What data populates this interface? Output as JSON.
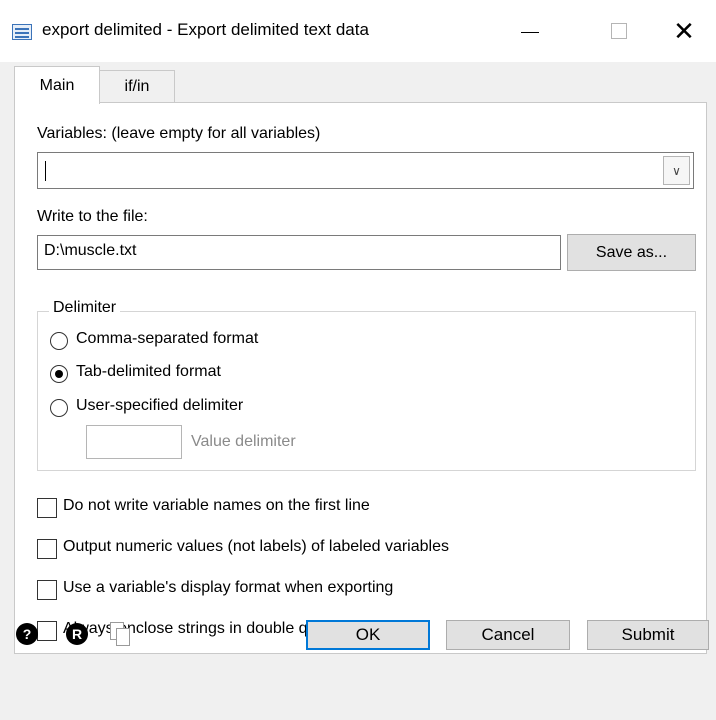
{
  "window": {
    "title": "export delimited - Export delimited text data",
    "minimize": "—",
    "close": "✕"
  },
  "tabs": [
    {
      "label": "Main",
      "active": true
    },
    {
      "label": "if/in",
      "active": false
    }
  ],
  "main": {
    "variables_label": "Variables: (leave empty for all variables)",
    "variables_value": "",
    "file_label": "Write to the file:",
    "file_value": "D:\\muscle.txt",
    "save_as": "Save as...",
    "delimiter": {
      "legend": "Delimiter",
      "options": [
        {
          "label": "Comma-separated format",
          "selected": false
        },
        {
          "label": "Tab-delimited format",
          "selected": true
        },
        {
          "label": "User-specified delimiter",
          "selected": false
        }
      ],
      "value_delimiter_label": "Value delimiter",
      "value_delimiter_value": ""
    },
    "checkboxes": [
      {
        "label": "Do not write variable names on the first line",
        "checked": false
      },
      {
        "label": "Output numeric values (not labels) of labeled variables",
        "checked": false
      },
      {
        "label": "Use a variable's display format when exporting",
        "checked": false
      },
      {
        "label": "Always enclose strings in double quotes",
        "checked": false
      }
    ]
  },
  "footer": {
    "help_icon": "?",
    "reset_icon": "R",
    "ok": "OK",
    "cancel": "Cancel",
    "submit": "Submit"
  }
}
